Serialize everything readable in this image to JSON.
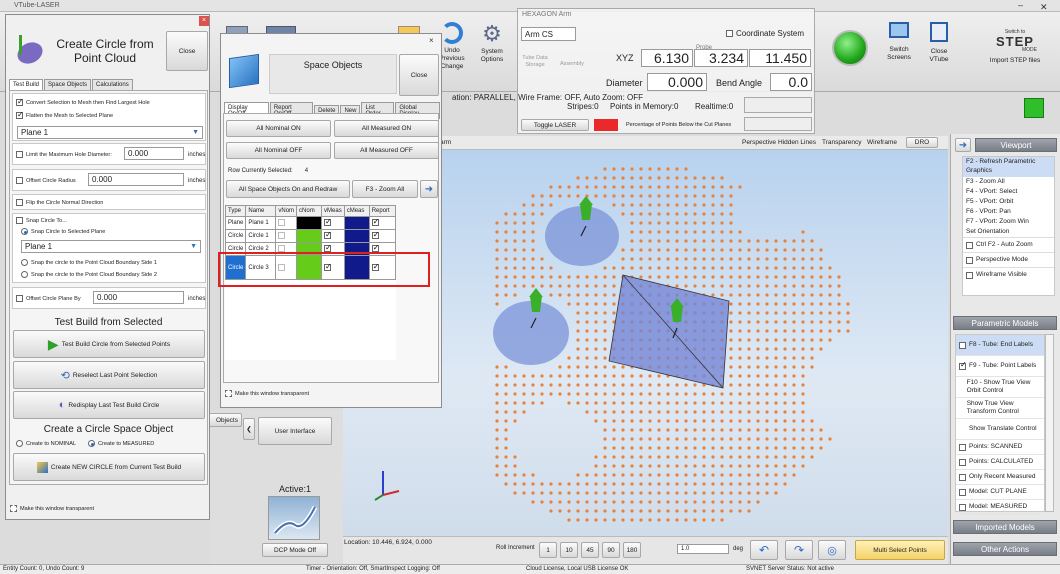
{
  "titlebar": {
    "app_title": "VTube-LASER"
  },
  "ribbon": {
    "undo_label": "Undo\nPrevious\nChange",
    "system_options_label": "System\nOptions",
    "switch_screens_label": "Switch\nScreens",
    "close_vtube_label": "Close\nVTube",
    "import_step_label": "Import STEP files",
    "step_logo_top": "Switch to",
    "step_logo_main": "STEP",
    "step_logo_bottom": "MODE"
  },
  "hexagon": {
    "title": "HEXAGON Arm",
    "arm_cs": "Arm CS",
    "coordinate_system": "Coordinate System",
    "tube_data_storage": "Tube Data\nStorage",
    "assembly": "Assembly",
    "probe_label": "Probe",
    "xyz_label": "XYZ",
    "x": "6.130",
    "y": "3.234",
    "z": "11.450",
    "diameter_label": "Diameter",
    "diameter": "0.000",
    "bend_angle_label": "Bend Angle",
    "bend_angle": "0.0",
    "stripes": "Stripes:0",
    "points_in_memory": "Points in Memory:0",
    "realtime": "Realtime:0",
    "toggle_laser": "Toggle LASER",
    "pct_below": "Percentage of Points Below the Cut Planes"
  },
  "status_line": "ation: PARALLEL, Wire Frame: OFF, Auto Zoom: OFF",
  "viewport_toolbar": {
    "left_label": "arm",
    "perspective": "Perspective",
    "hidden_lines": "Hidden Lines",
    "transparency": "Transparency",
    "wireframe": "Wireframe",
    "dro": "DRO"
  },
  "circle_window": {
    "title": "Create Circle from Point Cloud",
    "close": "Close",
    "tabs": [
      "Test Build",
      "Space Objects",
      "Calculations"
    ],
    "convert_mesh": "Convert Selection to Mesh then Find Largest Hole",
    "flatten_mesh": "Flatten the Mesh to Selected Plane",
    "plane_select": "Plane 1",
    "limit_diameter": "Limit the Maximum Hole Diameter:",
    "limit_value": "0.000",
    "inches": "inches",
    "offset_radius": "Offset Circle Radius",
    "offset_radius_value": "0.000",
    "flip_normal": "Flip the Circle Normal Direction",
    "snap_to": "Snap Circle To...",
    "snap_plane": "Snap Circle to Selected Plane",
    "snap_plane_value": "Plane 1",
    "snap_side1": "Snap the circle to the Point Cloud Boundary Side 1",
    "snap_side2": "Snap the circle to the Point Cloud Boundary Side 2",
    "offset_plane": "Offset Circle Plane By",
    "offset_plane_value": "0.000",
    "test_build_header": "Test Build from Selected",
    "test_build_btn": "Test Build Circle from Selected Points",
    "reselect_btn": "Reselect Last Point Selection",
    "redisplay_btn": "Redisplay Last Test Build Circle",
    "create_header": "Create a Circle Space Object",
    "create_nominal": "Create to NOMINAL",
    "create_measured": "Create to MEASURED",
    "create_new_btn": "Create NEW CIRCLE from Current Test Build",
    "transparent": "Make this window transparent"
  },
  "space_window": {
    "title": "Space Objects",
    "close": "Close",
    "tabs": [
      "Display On/Off",
      "Report On/Off",
      "Delete",
      "New",
      "List Order",
      "Global Display"
    ],
    "all_nominal_on": "All Nominal ON",
    "all_measured_on": "All Measured ON",
    "all_nominal_off": "All Nominal OFF",
    "all_measured_off": "All Measured OFF",
    "row_current_label": "Row Currently Selected:",
    "row_current": "4",
    "all_on_redraw": "All Space Objects On and Redraw",
    "zoom_all": "F3 - Zoom All",
    "columns": [
      "Type",
      "Name",
      "vNom",
      "cNom",
      "vMeas",
      "cMeas",
      "Report"
    ],
    "rows": [
      {
        "type": "Plane",
        "name": "Plane 1",
        "cnom": "#000000"
      },
      {
        "type": "Circle",
        "name": "Circle 1",
        "cnom": "#66cc1a"
      },
      {
        "type": "Circle",
        "name": "Circle 2",
        "cnom": "#66cc1a"
      },
      {
        "type": "Circle",
        "name": "Circle 3",
        "cnom": "#66cc1a"
      }
    ],
    "transparent": "Make this window transparent"
  },
  "under_panel": {
    "objects_label": "Objects",
    "user_interface": "User Interface",
    "active": "Active:1",
    "dcp_mode": "DCP Mode Off"
  },
  "viewport_bottom": {
    "location": "Location: 10.446, 6.924, 0.000",
    "roll_increment": "Roll Increment",
    "rolls": [
      "1",
      "10",
      "45",
      "90",
      "180"
    ],
    "roll_value": "1.0",
    "deg": "deg",
    "multi_select": "Multi Select Points"
  },
  "right_panel": {
    "viewport_header": "Viewport",
    "viewport_items": [
      "F2 - Refresh Parametric Graphics",
      "F3 - Zoom All",
      "F4 - VPort: Select",
      "F5 - VPort: Orbit",
      "F6 - VPort: Pan",
      "F7 - VPort: Zoom Win",
      "Set Orientation"
    ],
    "ctrl_f2": "Ctrl F2 - Auto Zoom",
    "perspective_mode": "Perspective Mode",
    "wireframe_visible": "Wireframe Visible",
    "parametric_header": "Parametric Models",
    "param_items": [
      {
        "label": "F8 - Tube: End Labels",
        "on": false,
        "sel": true
      },
      {
        "label": "F9 - Tube: Point Labels",
        "on": true,
        "sel": false
      },
      {
        "label": "F10 - Show True View Orbit Control",
        "on": null,
        "sel": false
      },
      {
        "label": "Show True View Transform Control",
        "on": null,
        "sel": false
      },
      {
        "label": "Show Translate Control",
        "on": null,
        "sel": false
      },
      {
        "label": "Points: SCANNED",
        "on": false,
        "sel": false
      },
      {
        "label": "Points: CALCULATED",
        "on": false,
        "sel": false
      },
      {
        "label": "Only Recent Measured",
        "on": false,
        "sel": false
      },
      {
        "label": "Model: CUT PLANE",
        "on": false,
        "sel": false
      },
      {
        "label": "Model: MEASURED",
        "on": false,
        "sel": false
      }
    ],
    "imported_header": "Imported Models",
    "other_header": "Other Actions"
  },
  "statusbar": {
    "entity": "Entity Count: 0, Undo Count: 9",
    "timer": "Timer - Orientation: Off, SmartInspect Logging: Off",
    "license": "Cloud License, Local USB License OK",
    "svnet": "SVNET Server Status: Not active"
  },
  "colors": {
    "accent": "#1f6fd0",
    "points": "#e8823a",
    "highlight_box": "#e02020",
    "viewport_bg": "#c9ddf2"
  }
}
